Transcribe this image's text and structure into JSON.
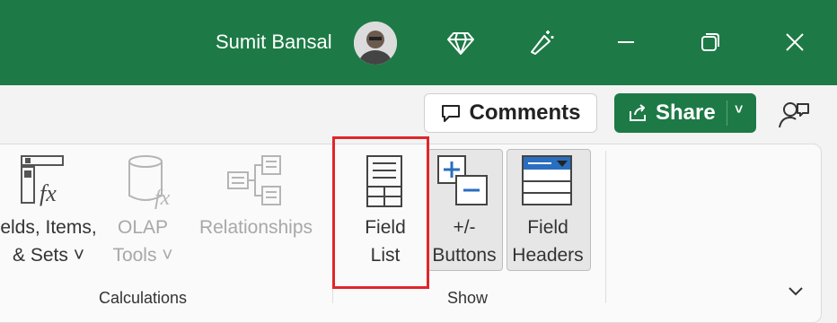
{
  "titlebar": {
    "user_name": "Sumit Bansal",
    "icons": [
      "premium-diamond-icon",
      "coauthor-wand-icon",
      "minimize-icon",
      "restore-icon",
      "close-icon"
    ],
    "background": "#1d7a46"
  },
  "ribbon_top": {
    "comments_label": "Comments",
    "share_label": "Share"
  },
  "groups": {
    "calculations": {
      "label": "Calculations",
      "fields_items": {
        "line1": "elds, Items,",
        "line2": "& Sets ˅"
      },
      "olap": {
        "line1": "OLAP",
        "line2": "Tools ˅"
      },
      "relationships": {
        "line1": "Relationships"
      }
    },
    "show": {
      "label": "Show",
      "field_list": {
        "line1": "Field",
        "line2": "List"
      },
      "buttons": {
        "line1": "+/-",
        "line2": "Buttons"
      },
      "field_headers": {
        "line1": "Field",
        "line2": "Headers"
      }
    }
  },
  "colors": {
    "accent": "#1d7a46",
    "highlight": "#e0262b"
  }
}
